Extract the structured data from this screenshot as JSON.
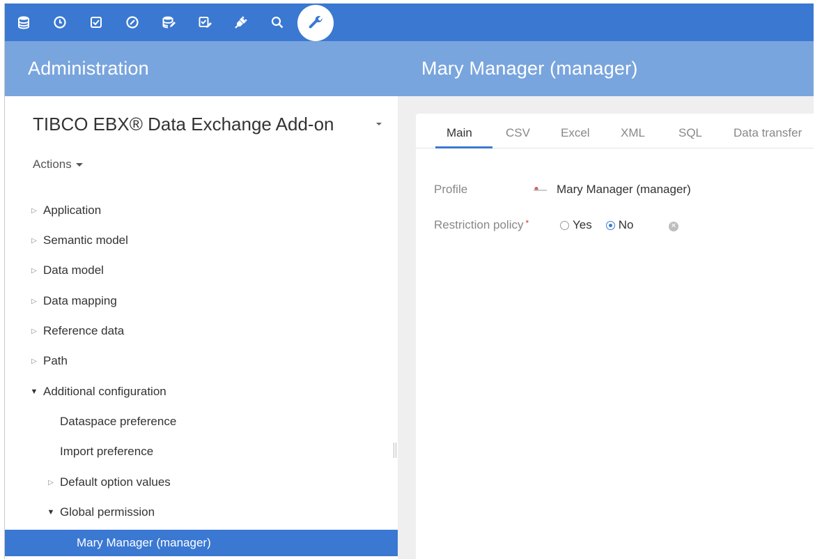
{
  "toolbar": {
    "icons": [
      "database-icon",
      "clock-icon",
      "checkbox-icon",
      "gauge-icon",
      "database-edit-icon",
      "task-edit-icon",
      "plug-icon",
      "search-icon",
      "wrench-icon"
    ],
    "active_icon": "wrench-icon",
    "color": "#3a78d2"
  },
  "header": {
    "left_title": "Administration",
    "right_title": "Mary Manager (manager)"
  },
  "left_panel": {
    "dataset_title": "TIBCO EBX® Data Exchange Add-on",
    "actions_label": "Actions",
    "tree": [
      {
        "label": "Application",
        "state": "collapsed",
        "level": 0
      },
      {
        "label": "Semantic model",
        "state": "collapsed",
        "level": 0
      },
      {
        "label": "Data model",
        "state": "collapsed",
        "level": 0
      },
      {
        "label": "Data mapping",
        "state": "collapsed",
        "level": 0
      },
      {
        "label": "Reference data",
        "state": "collapsed",
        "level": 0
      },
      {
        "label": "Path",
        "state": "collapsed",
        "level": 0
      },
      {
        "label": "Additional configuration",
        "state": "expanded",
        "level": 0
      },
      {
        "label": "Dataspace preference",
        "state": "leaf",
        "level": 1
      },
      {
        "label": "Import preference",
        "state": "leaf",
        "level": 1
      },
      {
        "label": "Default option values",
        "state": "collapsed",
        "level": 1
      },
      {
        "label": "Global permission",
        "state": "expanded",
        "level": 1
      },
      {
        "label": "Mary Manager (manager)",
        "state": "selected",
        "level": 2
      }
    ]
  },
  "tabs": [
    {
      "label": "Main",
      "active": true
    },
    {
      "label": "CSV",
      "active": false
    },
    {
      "label": "Excel",
      "active": false
    },
    {
      "label": "XML",
      "active": false
    },
    {
      "label": "SQL",
      "active": false
    },
    {
      "label": "Data transfer",
      "active": false
    }
  ],
  "form": {
    "profile_label": "Profile",
    "profile_value": "Mary Manager (manager)",
    "restriction_label": "Restriction policy",
    "required_mark": "*",
    "options": [
      {
        "label": "Yes",
        "checked": false
      },
      {
        "label": "No",
        "checked": true
      }
    ]
  }
}
